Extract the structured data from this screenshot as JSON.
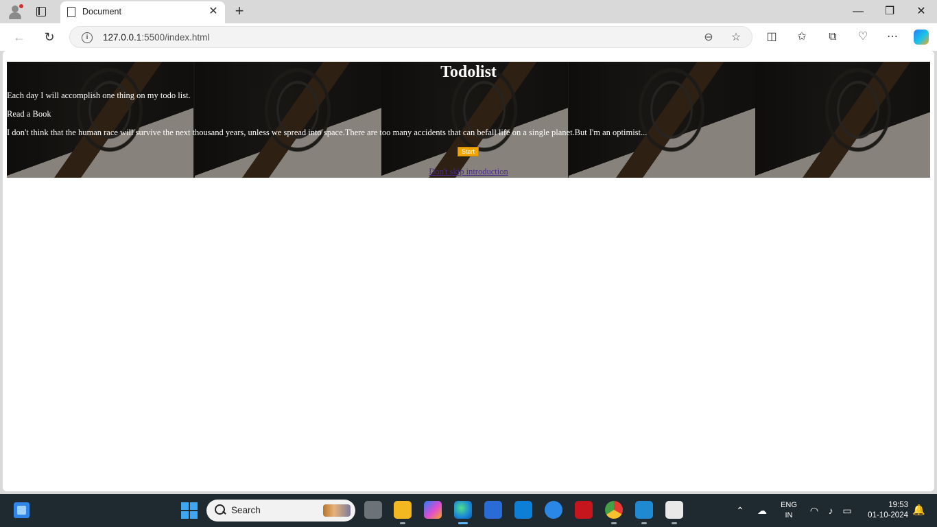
{
  "browser": {
    "tab": {
      "title": "Document"
    },
    "address": {
      "host": "127.0.0.1",
      "path": ":5500/index.html"
    }
  },
  "page": {
    "title": "Todolist",
    "intro": "Each day I will accomplish one thing on my todo list.",
    "task": "Read a Book",
    "quote": "I don't think that the human race will survive the next thousand years, unless we spread into space.There are too many accidents that can befall life on a single planet.But I'm an optimist...",
    "start_button": "Start",
    "skip_link": "Don't skip introduction"
  },
  "taskbar": {
    "search_placeholder": "Search",
    "language": "ENG",
    "region": "IN",
    "time": "19:53",
    "date": "01-10-2024"
  }
}
